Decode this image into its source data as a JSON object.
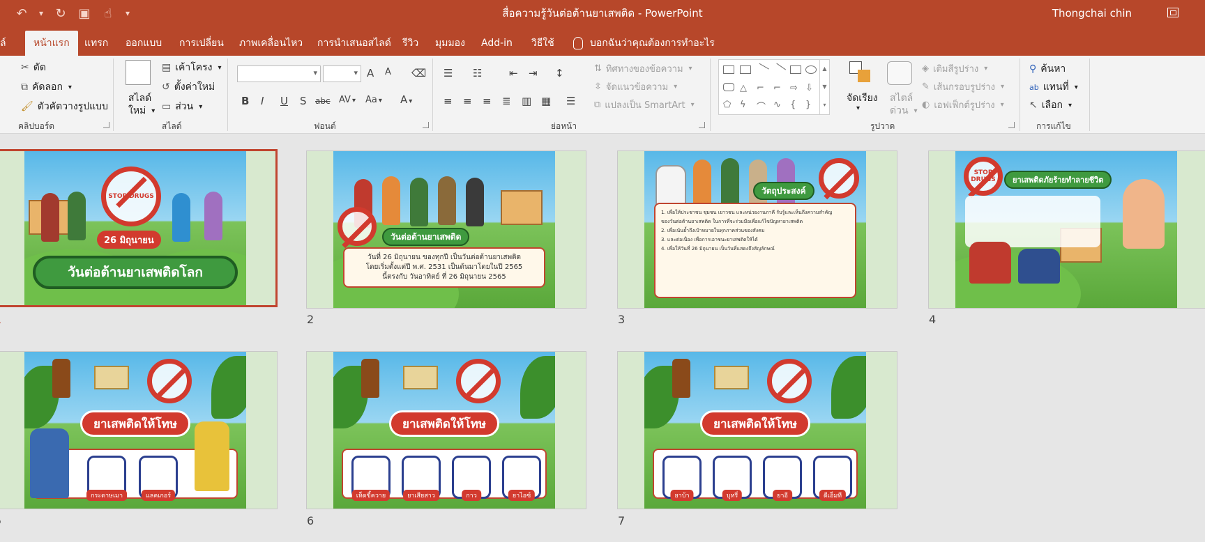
{
  "window": {
    "title": "สื่อความรู้วันต่อต้านยาเสพติด  -  PowerPoint",
    "user": "Thongchai chin"
  },
  "tabs": [
    {
      "label": "ล์",
      "active": false
    },
    {
      "label": "หน้าแรก",
      "active": true
    },
    {
      "label": "แทรก",
      "active": false
    },
    {
      "label": "ออกแบบ",
      "active": false
    },
    {
      "label": "การเปลี่ยน",
      "active": false
    },
    {
      "label": "ภาพเคลื่อนไหว",
      "active": false
    },
    {
      "label": "การนำเสนอสไลด์",
      "active": false
    },
    {
      "label": "รีวิว",
      "active": false
    },
    {
      "label": "มุมมอง",
      "active": false
    },
    {
      "label": "Add-in",
      "active": false
    },
    {
      "label": "วิธีใช้",
      "active": false
    }
  ],
  "tell_me": "บอกฉันว่าคุณต้องการทำอะไร",
  "ribbon": {
    "clipboard": {
      "cut": "ตัด",
      "copy": "คัดลอก",
      "format_painter": "ตัวคัดวางรูปแบบ",
      "label": "คลิปบอร์ด"
    },
    "slides": {
      "new_slide_1": "สไลด์",
      "new_slide_2": "ใหม่",
      "layout": "เค้าโครง",
      "reset": "ตั้งค่าใหม่",
      "section": "ส่วน",
      "label": "สไลด์"
    },
    "font": {
      "label": "ฟอนต์",
      "bold": "B",
      "italic": "I",
      "underline": "U",
      "shadow": "S",
      "strike": "abc",
      "spacing": "AV",
      "case": "Aa",
      "color": "A",
      "grow": "A",
      "shrink": "A"
    },
    "paragraph": {
      "label": "ย่อหน้า",
      "text_direction": "ทิศทางของข้อความ",
      "align_text": "จัดแนวข้อความ",
      "smartart": "แปลงเป็น SmartArt"
    },
    "drawing": {
      "label": "รูปวาด",
      "arrange": "จัดเรียง",
      "quick_styles_1": "สไตล์",
      "quick_styles_2": "ด่วน",
      "shape_fill": "เติมสีรูปร่าง",
      "shape_outline": "เส้นกรอบรูปร่าง",
      "shape_effects": "เอฟเฟ็กต์รูปร่าง"
    },
    "editing": {
      "label": "การแก้ไข",
      "find": "ค้นหา",
      "replace": "แทนที่",
      "select": "เลือก"
    }
  },
  "slides": [
    {
      "number": "1",
      "selected": true,
      "badge": "STOP DRUGS",
      "date": "26 มิถุนายน",
      "title": "วันต่อต้านยาเสพติดโลก"
    },
    {
      "number": "2",
      "selected": false,
      "badge": "วันต่อต้านยาเสพติด",
      "lines": [
        "วันที่ 26 มิถุนายน ของทุกปี เป็นวันต่อต้านยาเสพติด",
        "โดยเริ่มตั้งแต่ปี พ.ศ. 2531 เป็นต้นมาโดยในปี 2565",
        "นี้ตรงกับ วันอาทิตย์ ที่ 26 มิถุนายน 2565"
      ]
    },
    {
      "number": "3",
      "selected": false,
      "badge": "วัตถุประสงค์",
      "lines": [
        "1. เพื่อให้ประชาชน ชุมชน เยาวชน และหน่วยงานภาคี รับรู้และเห็นถึงความสำคัญ",
        "ของวันต่อต้านยาเสพติด ในการที่จะร่วมมือเพื่อแก้ไขปัญหายาเสพติด",
        "2. เพื่อเน้นย้ำถึงเป้าหมายในทุกภาคส่วนของสังคม",
        "3. และต่อเนื่อง เพื่อการเอาชนะยาเสพติดให้ได้",
        "4. เพื่อให้วันที่ 26 มิถุนายน เป็นวันที่แสดงถึงสัญลักษณ์"
      ]
    },
    {
      "number": "4",
      "selected": false,
      "title": "ยาเสพติดภัยร้ายทำลายชีวิต",
      "badge": "STOP DRUGS"
    },
    {
      "number": "5",
      "selected": false,
      "title": "ยาเสพติดให้โทษ",
      "cards": [
        "กระดาษเมา",
        "แลคเกอร์"
      ]
    },
    {
      "number": "6",
      "selected": false,
      "title": "ยาเสพติดให้โทษ",
      "cards": [
        "เห็ดขี้ควาย",
        "ยาเสียสาว",
        "กาว",
        "ยาไอซ์"
      ]
    },
    {
      "number": "7",
      "selected": false,
      "title": "ยาเสพติดให้โทษ",
      "cards": [
        "ยาบ้า",
        "บุหรี่",
        "ยาอี",
        "ดีเอ็มที"
      ]
    }
  ],
  "colors": {
    "accent": "#b7472a",
    "selection": "#c0452f",
    "ribbon_bg": "#f3f3f3",
    "workspace_bg": "#e6e6e6"
  }
}
